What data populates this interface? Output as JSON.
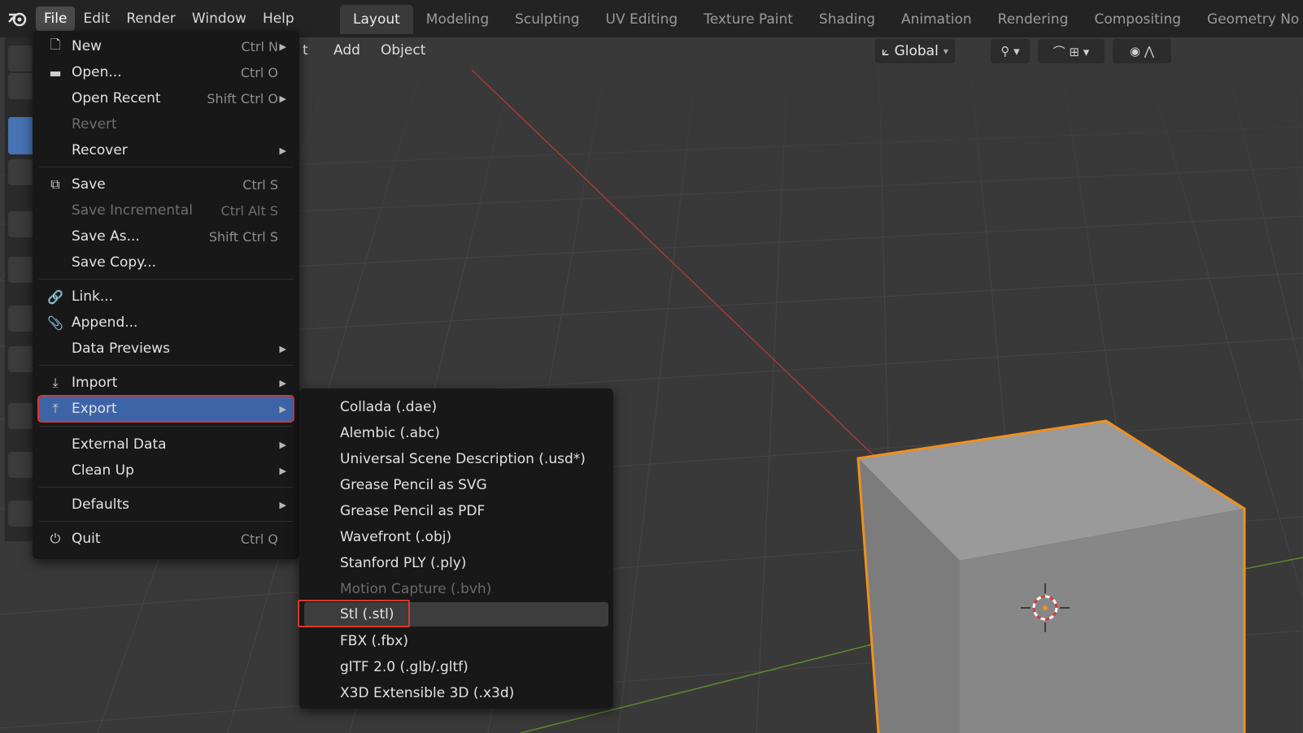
{
  "topbar": {
    "menus": [
      "File",
      "Edit",
      "Render",
      "Window",
      "Help"
    ],
    "workspaces": [
      "Layout",
      "Modeling",
      "Sculpting",
      "UV Editing",
      "Texture Paint",
      "Shading",
      "Animation",
      "Rendering",
      "Compositing",
      "Geometry No"
    ]
  },
  "viewport_header": {
    "partial_menu": "t",
    "add": "Add",
    "object": "Object",
    "orientation": "Global"
  },
  "file_menu": {
    "items": [
      {
        "label": "New",
        "shortcut": "Ctrl N",
        "icon": "new-file-icon",
        "submenu": true
      },
      {
        "label": "Open...",
        "shortcut": "Ctrl O",
        "icon": "folder-icon"
      },
      {
        "label": "Open Recent",
        "shortcut": "Shift Ctrl O",
        "submenu": true
      },
      {
        "label": "Revert",
        "disabled": true
      },
      {
        "label": "Recover",
        "submenu": true
      },
      {
        "label": "Save",
        "shortcut": "Ctrl S",
        "icon": "save-icon"
      },
      {
        "label": "Save Incremental",
        "shortcut": "Ctrl Alt S",
        "disabled": true
      },
      {
        "label": "Save As...",
        "shortcut": "Shift Ctrl S"
      },
      {
        "label": "Save Copy..."
      },
      {
        "label": "Link...",
        "icon": "link-icon"
      },
      {
        "label": "Append...",
        "icon": "paperclip-icon"
      },
      {
        "label": "Data Previews",
        "submenu": true
      },
      {
        "label": "Import",
        "icon": "import-icon",
        "submenu": true
      },
      {
        "label": "Export",
        "icon": "export-icon",
        "submenu": true,
        "highlighted": true
      },
      {
        "label": "External Data",
        "submenu": true
      },
      {
        "label": "Clean Up",
        "submenu": true
      },
      {
        "label": "Defaults",
        "submenu": true
      },
      {
        "label": "Quit",
        "shortcut": "Ctrl Q",
        "icon": "power-icon"
      }
    ]
  },
  "export_menu": {
    "items": [
      {
        "label": "Collada (.dae)"
      },
      {
        "label": "Alembic (.abc)"
      },
      {
        "label": "Universal Scene Description (.usd*)"
      },
      {
        "label": "Grease Pencil as SVG"
      },
      {
        "label": "Grease Pencil as PDF"
      },
      {
        "label": "Wavefront (.obj)"
      },
      {
        "label": "Stanford PLY (.ply)"
      },
      {
        "label": "Motion Capture (.bvh)",
        "disabled": true
      },
      {
        "label": "Stl (.stl)",
        "highlighted": true
      },
      {
        "label": "FBX (.fbx)"
      },
      {
        "label": "glTF 2.0 (.glb/.gltf)"
      },
      {
        "label": "X3D Extensible 3D (.x3d)"
      }
    ]
  },
  "colors": {
    "highlight_outline": "#d9392b",
    "selection_blue": "#3e64a8",
    "cube_outline": "#f0901e"
  }
}
